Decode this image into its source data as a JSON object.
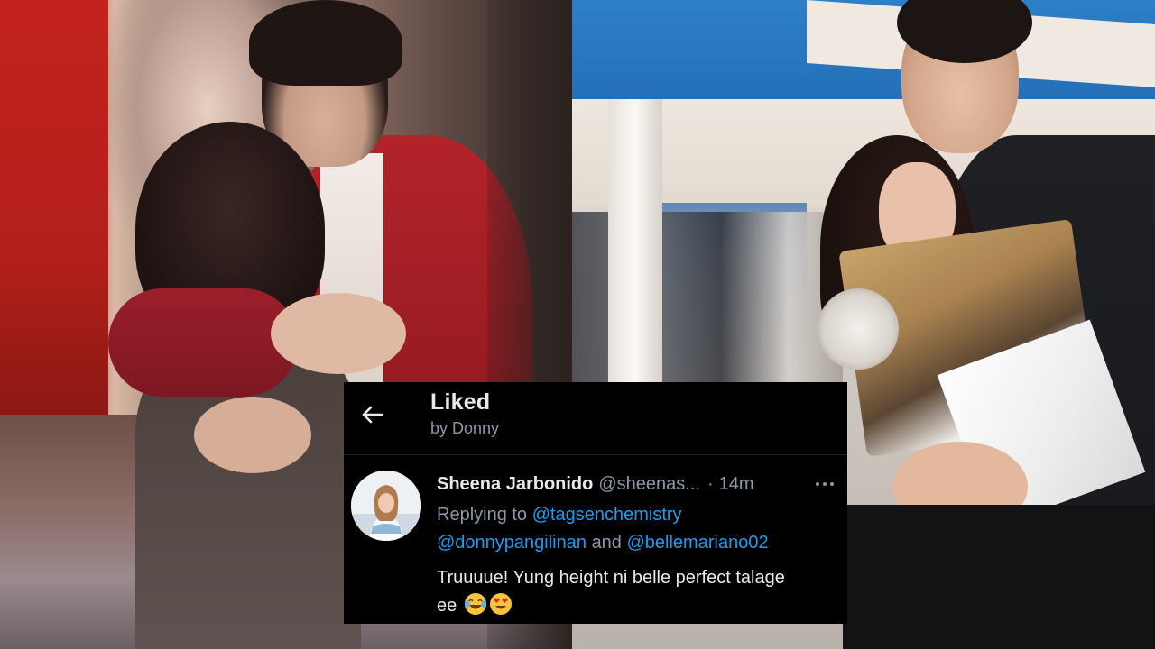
{
  "header": {
    "title": "Liked",
    "subtitle": "by Donny"
  },
  "tweet": {
    "author_name": "Sheena Jarbonido",
    "author_handle": "@sheenas...",
    "separator": "·",
    "time": "14m",
    "replying_label": "Replying to",
    "mention_1": "@tagsenchemistry",
    "mention_2": "@donnypangilinan",
    "and_label": "and",
    "mention_3": "@bellemariano02",
    "text_line_1": "Truuuue! Yung height ni belle perfect talage",
    "text_line_2": "ee"
  },
  "icons": {
    "back": "arrow-left-icon",
    "more": "more-horizontal-icon",
    "emoji_1": "face-with-tears-of-joy-emoji",
    "emoji_2": "smiling-face-with-heart-eyes-emoji"
  },
  "colors": {
    "card_background": "#000000",
    "primary_text": "#e7e9ea",
    "secondary_text": "#8b98a5",
    "link": "#1d9bf0"
  }
}
